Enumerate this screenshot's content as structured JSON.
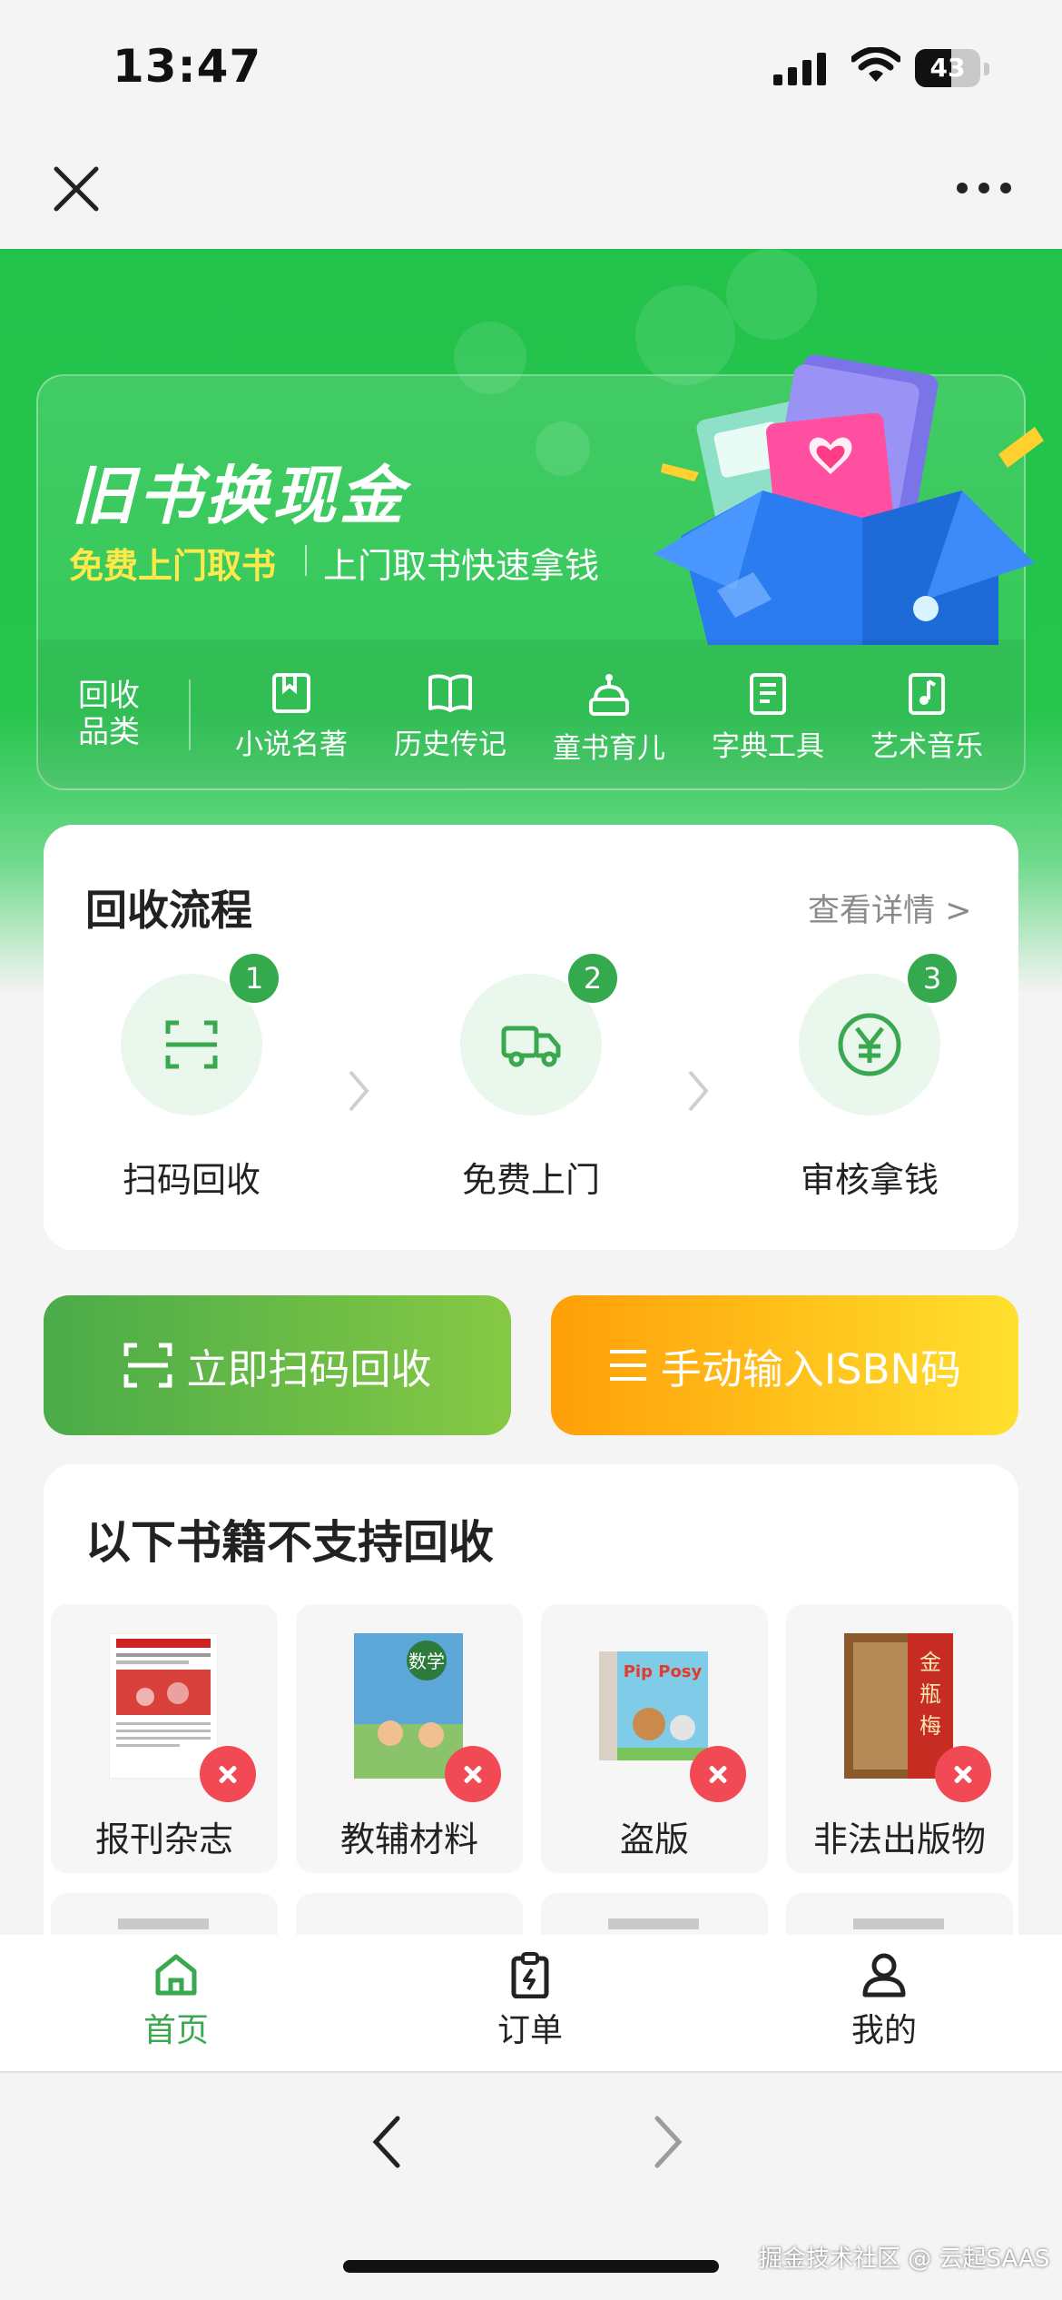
{
  "status_bar": {
    "time": "13:47",
    "battery": "43"
  },
  "banner": {
    "title": "旧书换现金",
    "subtitle_highlight": "免费上门取书",
    "subtitle": "上门取书快速拿钱",
    "category_label": "回收\n品类",
    "categories": [
      {
        "label": "小说名著",
        "icon": "book-bookmark-icon"
      },
      {
        "label": "历史传记",
        "icon": "open-book-icon"
      },
      {
        "label": "童书育儿",
        "icon": "toy-robot-icon"
      },
      {
        "label": "字典工具",
        "icon": "dictionary-icon"
      },
      {
        "label": "艺术音乐",
        "icon": "music-book-icon"
      }
    ]
  },
  "process": {
    "title": "回收流程",
    "detail_link": "查看详情 >",
    "steps": [
      {
        "num": "1",
        "label": "扫码回收",
        "icon": "scan-icon"
      },
      {
        "num": "2",
        "label": "免费上门",
        "icon": "truck-icon"
      },
      {
        "num": "3",
        "label": "审核拿钱",
        "icon": "yen-icon"
      }
    ]
  },
  "actions": {
    "scan_label": "立即扫码回收",
    "isbn_label": "手动输入ISBN码"
  },
  "unsupported": {
    "title": "以下书籍不支持回收",
    "items": [
      {
        "label": "报刊杂志"
      },
      {
        "label": "教辅材料"
      },
      {
        "label": "盗版"
      },
      {
        "label": "非法出版物"
      }
    ]
  },
  "tabbar": {
    "tabs": [
      {
        "label": "首页",
        "icon": "home-icon",
        "active": true
      },
      {
        "label": "订单",
        "icon": "order-clipboard-icon",
        "active": false
      },
      {
        "label": "我的",
        "icon": "profile-icon",
        "active": false
      }
    ]
  },
  "watermark": "掘金技术社区 @ 云起SAAS",
  "colors": {
    "brand_green": "#25c54d",
    "step_green": "#35a94e",
    "isbn_orange": "#ff9f08",
    "reject_red": "#f14a55"
  }
}
